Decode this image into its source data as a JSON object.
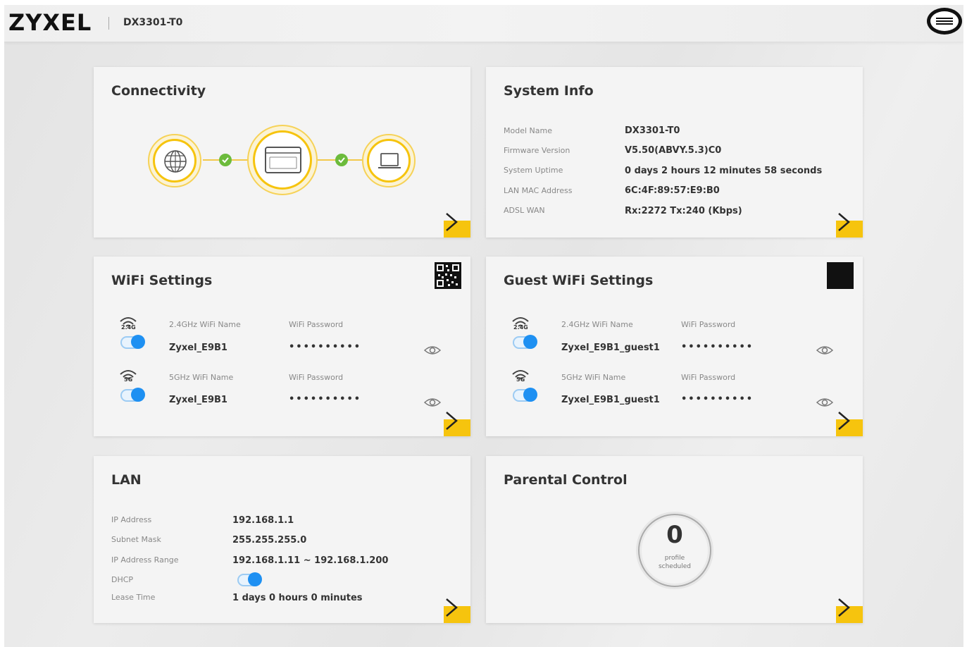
{
  "header": {
    "brand": "ZYXEL",
    "model": "DX3301-T0"
  },
  "colors": {
    "accent": "#f6c40e",
    "toggle_on": "#1e90f2",
    "connected": "#6cbb3c"
  },
  "connectivity": {
    "title": "Connectivity",
    "nodes": [
      "globe-icon",
      "router-icon",
      "laptop-icon"
    ],
    "status": [
      "connected",
      "connected"
    ]
  },
  "system_info": {
    "title": "System Info",
    "rows": [
      {
        "label": "Model Name",
        "value": "DX3301-T0"
      },
      {
        "label": "Firmware Version",
        "value": "V5.50(ABVY.5.3)C0"
      },
      {
        "label": "System Uptime",
        "value": "0 days 2 hours 12 minutes 58 seconds"
      },
      {
        "label": "LAN MAC Address",
        "value": "6C:4F:89:57:E9:B0"
      },
      {
        "label": "ADSL WAN",
        "value": "Rx:2272 Tx:240 (Kbps)"
      }
    ]
  },
  "wifi": {
    "title": "WiFi Settings",
    "rows": [
      {
        "band": "2.4G",
        "name_label": "2.4GHz WiFi Name",
        "pw_label": "WiFi Password",
        "name": "Zyxel_E9B1",
        "password": "••••••••••",
        "enabled": true
      },
      {
        "band": "5G",
        "name_label": "5GHz WiFi Name",
        "pw_label": "WiFi Password",
        "name": "Zyxel_E9B1",
        "password": "••••••••••",
        "enabled": true
      }
    ]
  },
  "guest_wifi": {
    "title": "Guest WiFi Settings",
    "rows": [
      {
        "band": "2.4G",
        "name_label": "2.4GHz WiFi Name",
        "pw_label": "WiFi Password",
        "name": "Zyxel_E9B1_guest1",
        "password": "••••••••••",
        "enabled": true
      },
      {
        "band": "5G",
        "name_label": "5GHz WiFi Name",
        "pw_label": "WiFi Password",
        "name": "Zyxel_E9B1_guest1",
        "password": "••••••••••",
        "enabled": true
      }
    ]
  },
  "lan": {
    "title": "LAN",
    "rows": [
      {
        "label": "IP Address",
        "value": "192.168.1.1"
      },
      {
        "label": "Subnet Mask",
        "value": "255.255.255.0"
      },
      {
        "label": "IP Address Range",
        "value": "192.168.1.11 ~ 192.168.1.200"
      },
      {
        "label": "DHCP",
        "value": ""
      },
      {
        "label": "Lease Time",
        "value": "1 days 0 hours 0 minutes"
      }
    ],
    "dhcp_enabled": true
  },
  "parental_control": {
    "title": "Parental Control",
    "count": "0",
    "caption_line1": "profile",
    "caption_line2": "scheduled"
  }
}
